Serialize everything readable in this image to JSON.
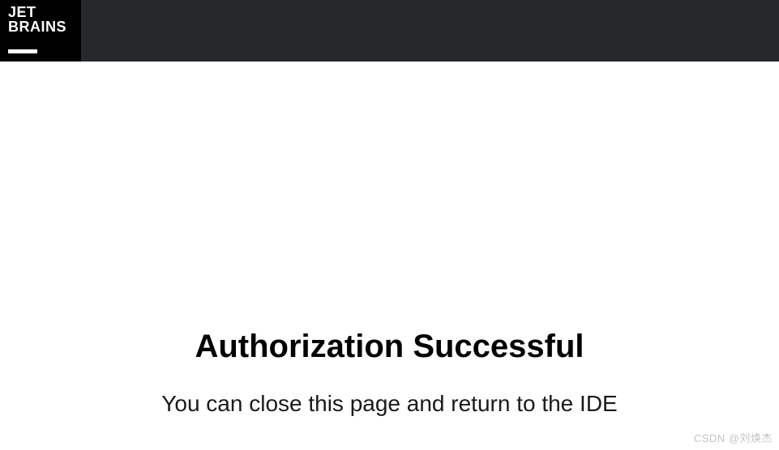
{
  "header": {
    "logo_line1": "JET",
    "logo_line2": "BRAINS"
  },
  "main": {
    "title": "Authorization Successful",
    "subtitle": "You can close this page and return to the IDE"
  },
  "watermark": "CSDN @刘焕杰"
}
